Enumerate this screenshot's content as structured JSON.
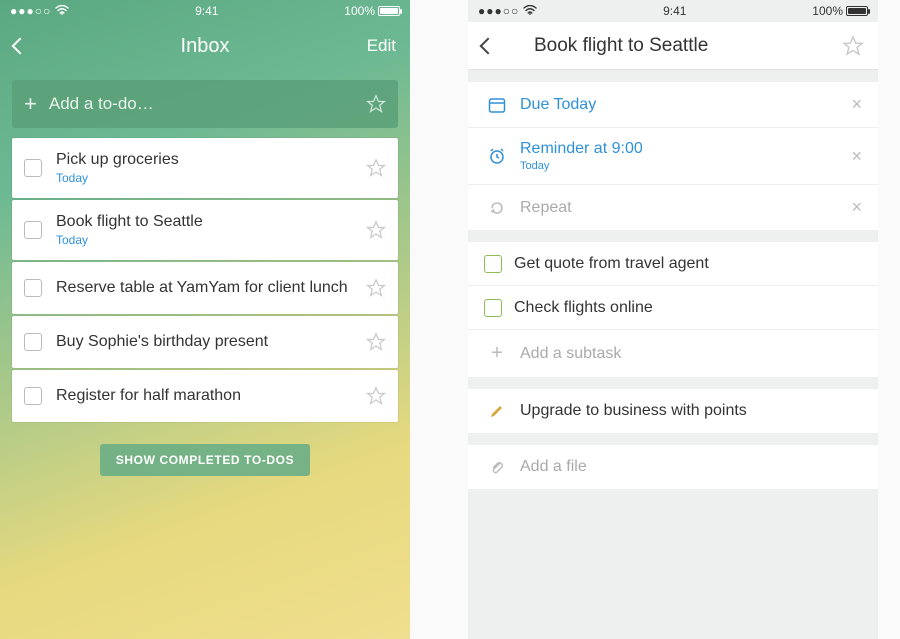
{
  "statusbar": {
    "carrier_dots": "●●●○○",
    "time": "9:41",
    "battery_pct": "100%"
  },
  "list_screen": {
    "nav_title": "Inbox",
    "nav_right": "Edit",
    "add_placeholder": "Add a to-do…",
    "show_completed": "SHOW COMPLETED TO-DOS",
    "items": [
      {
        "title": "Pick up groceries",
        "sub": "Today"
      },
      {
        "title": "Book flight to Seattle",
        "sub": "Today"
      },
      {
        "title": "Reserve table at YamYam for client lunch",
        "sub": ""
      },
      {
        "title": "Buy Sophie's birthday present",
        "sub": ""
      },
      {
        "title": "Register for half marathon",
        "sub": ""
      }
    ]
  },
  "detail_screen": {
    "nav_title": "Book flight to Seattle",
    "due": {
      "label": "Due Today"
    },
    "reminder": {
      "label": "Reminder at 9:00",
      "sub": "Today"
    },
    "repeat": {
      "label": "Repeat"
    },
    "subtasks": [
      {
        "label": "Get quote from travel agent"
      },
      {
        "label": "Check flights online"
      }
    ],
    "add_subtask": "Add a subtask",
    "note": "Upgrade to business with points",
    "add_file": "Add a file"
  }
}
